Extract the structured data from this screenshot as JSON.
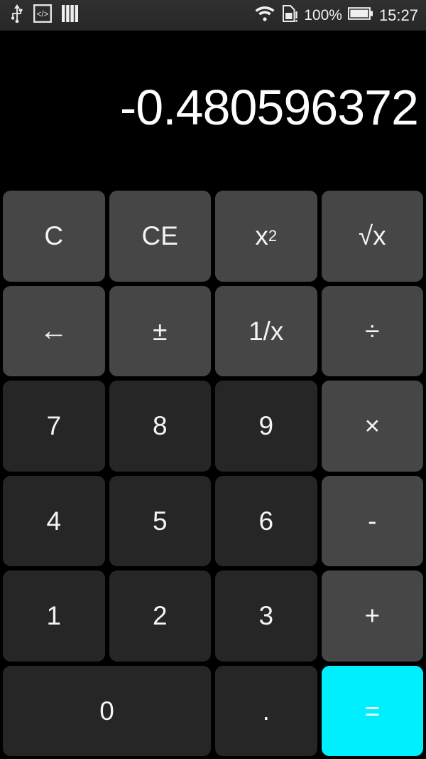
{
  "statusbar": {
    "left_icons": [
      {
        "name": "usb-icon",
        "label": "USB"
      },
      {
        "name": "developer-options-icon",
        "label": "</>"
      },
      {
        "name": "vertical-bars-icon",
        "label": "bars"
      }
    ],
    "right_icons": [
      {
        "name": "wifi-icon",
        "label": "WiFi"
      },
      {
        "name": "sim-card-alert-icon",
        "label": "SIM!"
      },
      {
        "name": "battery-icon",
        "label": "Battery"
      }
    ],
    "battery_percent": "100%",
    "clock": "15:27"
  },
  "display": {
    "value": "-0.480596372"
  },
  "keypad": {
    "rows": [
      [
        {
          "name": "key-clear",
          "label": "C",
          "kind": "fn"
        },
        {
          "name": "key-clear-entry",
          "label": "CE",
          "kind": "fn"
        },
        {
          "name": "key-square",
          "label": "x²",
          "kind": "fn"
        },
        {
          "name": "key-square-root",
          "label": "√x",
          "kind": "fn"
        }
      ],
      [
        {
          "name": "key-backspace",
          "label": "←",
          "kind": "fn"
        },
        {
          "name": "key-plus-minus",
          "label": "±",
          "kind": "fn"
        },
        {
          "name": "key-reciprocal",
          "label": "1/x",
          "kind": "fn"
        },
        {
          "name": "key-divide",
          "label": "÷",
          "kind": "op"
        }
      ],
      [
        {
          "name": "key-7",
          "label": "7",
          "kind": "num"
        },
        {
          "name": "key-8",
          "label": "8",
          "kind": "num"
        },
        {
          "name": "key-9",
          "label": "9",
          "kind": "num"
        },
        {
          "name": "key-multiply",
          "label": "×",
          "kind": "op"
        }
      ],
      [
        {
          "name": "key-4",
          "label": "4",
          "kind": "num"
        },
        {
          "name": "key-5",
          "label": "5",
          "kind": "num"
        },
        {
          "name": "key-6",
          "label": "6",
          "kind": "num"
        },
        {
          "name": "key-subtract",
          "label": "-",
          "kind": "op"
        }
      ],
      [
        {
          "name": "key-1",
          "label": "1",
          "kind": "num"
        },
        {
          "name": "key-2",
          "label": "2",
          "kind": "num"
        },
        {
          "name": "key-3",
          "label": "3",
          "kind": "num"
        },
        {
          "name": "key-add",
          "label": "+",
          "kind": "op"
        }
      ],
      [
        {
          "name": "key-0",
          "label": "0",
          "kind": "num",
          "wide": true
        },
        {
          "name": "key-decimal",
          "label": ".",
          "kind": "num"
        },
        {
          "name": "key-equals",
          "label": "=",
          "kind": "eq"
        }
      ]
    ]
  },
  "colors": {
    "background": "#000000",
    "statusbar_bg": "#2b2b2b",
    "function_key": "#464646",
    "number_key": "#262626",
    "equals_key": "#00efff",
    "text": "#f4f4f4"
  }
}
